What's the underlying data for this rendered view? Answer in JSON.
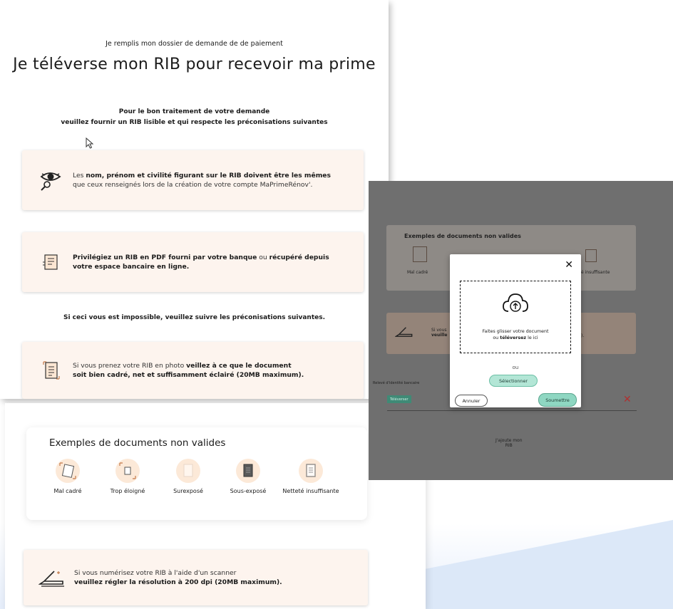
{
  "page": {
    "subtitle": "Je remplis mon dossier de demande de de paiement",
    "title": "Je téléverse mon RIB pour recevoir ma prime",
    "intro_line1": "Pour le bon traitement de votre demande",
    "intro_line2": "veuillez fournir un RIB lisible et qui respecte les préconisations suivantes"
  },
  "cards": [
    {
      "icon": "eye-magnifier-icon",
      "parts": [
        {
          "t": "Les "
        },
        {
          "b": "nom, prénom et civilité figurant sur le RIB doivent être les mêmes"
        },
        {
          "br": true
        },
        {
          "t": "que ceux renseignés lors de la création de votre compte MaPrimeRénov'."
        }
      ]
    },
    {
      "icon": "pdf-document-icon",
      "parts": [
        {
          "b": "Privilégiez un RIB en PDF fourni par votre banque"
        },
        {
          "t": " ou "
        },
        {
          "b": "récupéré depuis"
        },
        {
          "br": true
        },
        {
          "b": "votre espace bancaire en ligne."
        }
      ]
    },
    {
      "icon": "photo-document-icon",
      "parts": [
        {
          "t": "Si vous prenez votre RIB en photo "
        },
        {
          "b": "veillez à ce que le document"
        },
        {
          "br": true
        },
        {
          "b": "soit bien cadré, net et suffisamment éclairé (20MB maximum)."
        }
      ]
    },
    {
      "icon": "scanner-icon",
      "parts": [
        {
          "t": "Si vous numérisez votre RIB à l'aide d'un scanner"
        },
        {
          "br": true
        },
        {
          "b": "veuillez régler la résolution à 200 dpi (20MB maximum)."
        }
      ]
    }
  ],
  "note": "Si ceci vous est impossible, veuillez suivre les préconisations suivantes.",
  "examples": {
    "title": "Exemples de documents non valides",
    "items": [
      "Mal cadré",
      "Trop éloigné",
      "Surexposé",
      "Sous-exposé",
      "Netteté insuffisante"
    ]
  },
  "overlay": {
    "examples_title": "Exemples de documents non valides",
    "examples_first": "Mal cadré",
    "examples_last": "é insuffisante",
    "bg_scanner_line1": "Si vous",
    "bg_scanner_line2": "veuille",
    "bg_suffix": ").",
    "field_label": "Relevé d'identité bancaire",
    "field_tag": "Téléverser",
    "field_remove": "✕",
    "bg_add_line1": "J'ajoute mon",
    "bg_add_line2": "RIB",
    "modal": {
      "close": "✕",
      "drop_line1": "Faites glisser votre document",
      "drop_line2_pre": "ou ",
      "drop_line2_bold": "téléversez",
      "drop_line2_post": " le ici",
      "or": "ou",
      "select": "Sélectionner",
      "cancel": "Annuler",
      "submit": "Soumettre"
    }
  },
  "colors": {
    "card_bg": "#fdf4ee",
    "accent_green": "#8fd7c2",
    "remove_red": "#d23a3a"
  }
}
